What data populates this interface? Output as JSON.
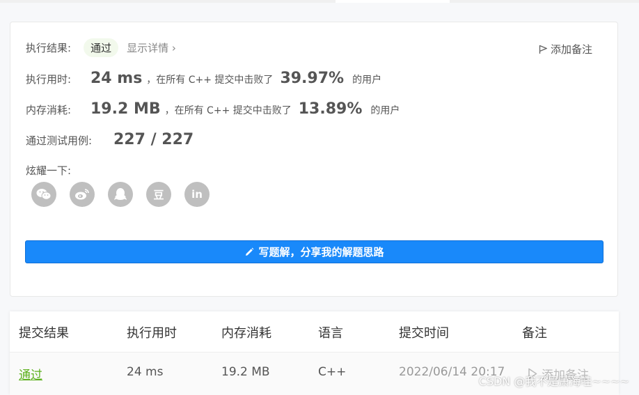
{
  "result": {
    "label": "执行结果:",
    "status": "通过",
    "details_link": "显示详情",
    "details_chevron": "›",
    "add_note": "添加备注"
  },
  "runtime": {
    "label": "执行用时:",
    "value": "24 ms",
    "text_mid": "，在所有 C++ 提交中击败了",
    "percent": "39.97%",
    "text_end": "的用户"
  },
  "memory": {
    "label": "内存消耗:",
    "value": "19.2 MB",
    "text_mid": "，在所有 C++ 提交中击败了",
    "percent": "13.89%",
    "text_end": "的用户"
  },
  "testcases": {
    "label": "通过测试用例:",
    "value": "227 / 227"
  },
  "share": {
    "label": "炫耀一下:",
    "icons": [
      "wechat-icon",
      "weibo-icon",
      "qq-icon",
      "douban-icon",
      "linkedin-icon"
    ],
    "douban_glyph": "豆",
    "linkedin_glyph": "in"
  },
  "solution_button": {
    "label": "写题解，分享我的解题思路",
    "color": "#1989fa"
  },
  "table": {
    "headers": [
      "提交结果",
      "执行用时",
      "内存消耗",
      "语言",
      "提交时间",
      "备注"
    ],
    "rows": [
      [
        "通过",
        "24 ms",
        "19.2 MB",
        "C++",
        "2022/06/14 20:17",
        "添加备注"
      ]
    ]
  },
  "watermark": "CSDN @我不是萧海哇~~~~",
  "colors": {
    "pass_green": "#5cb01c",
    "badge_bg": "#f2f9ec"
  }
}
